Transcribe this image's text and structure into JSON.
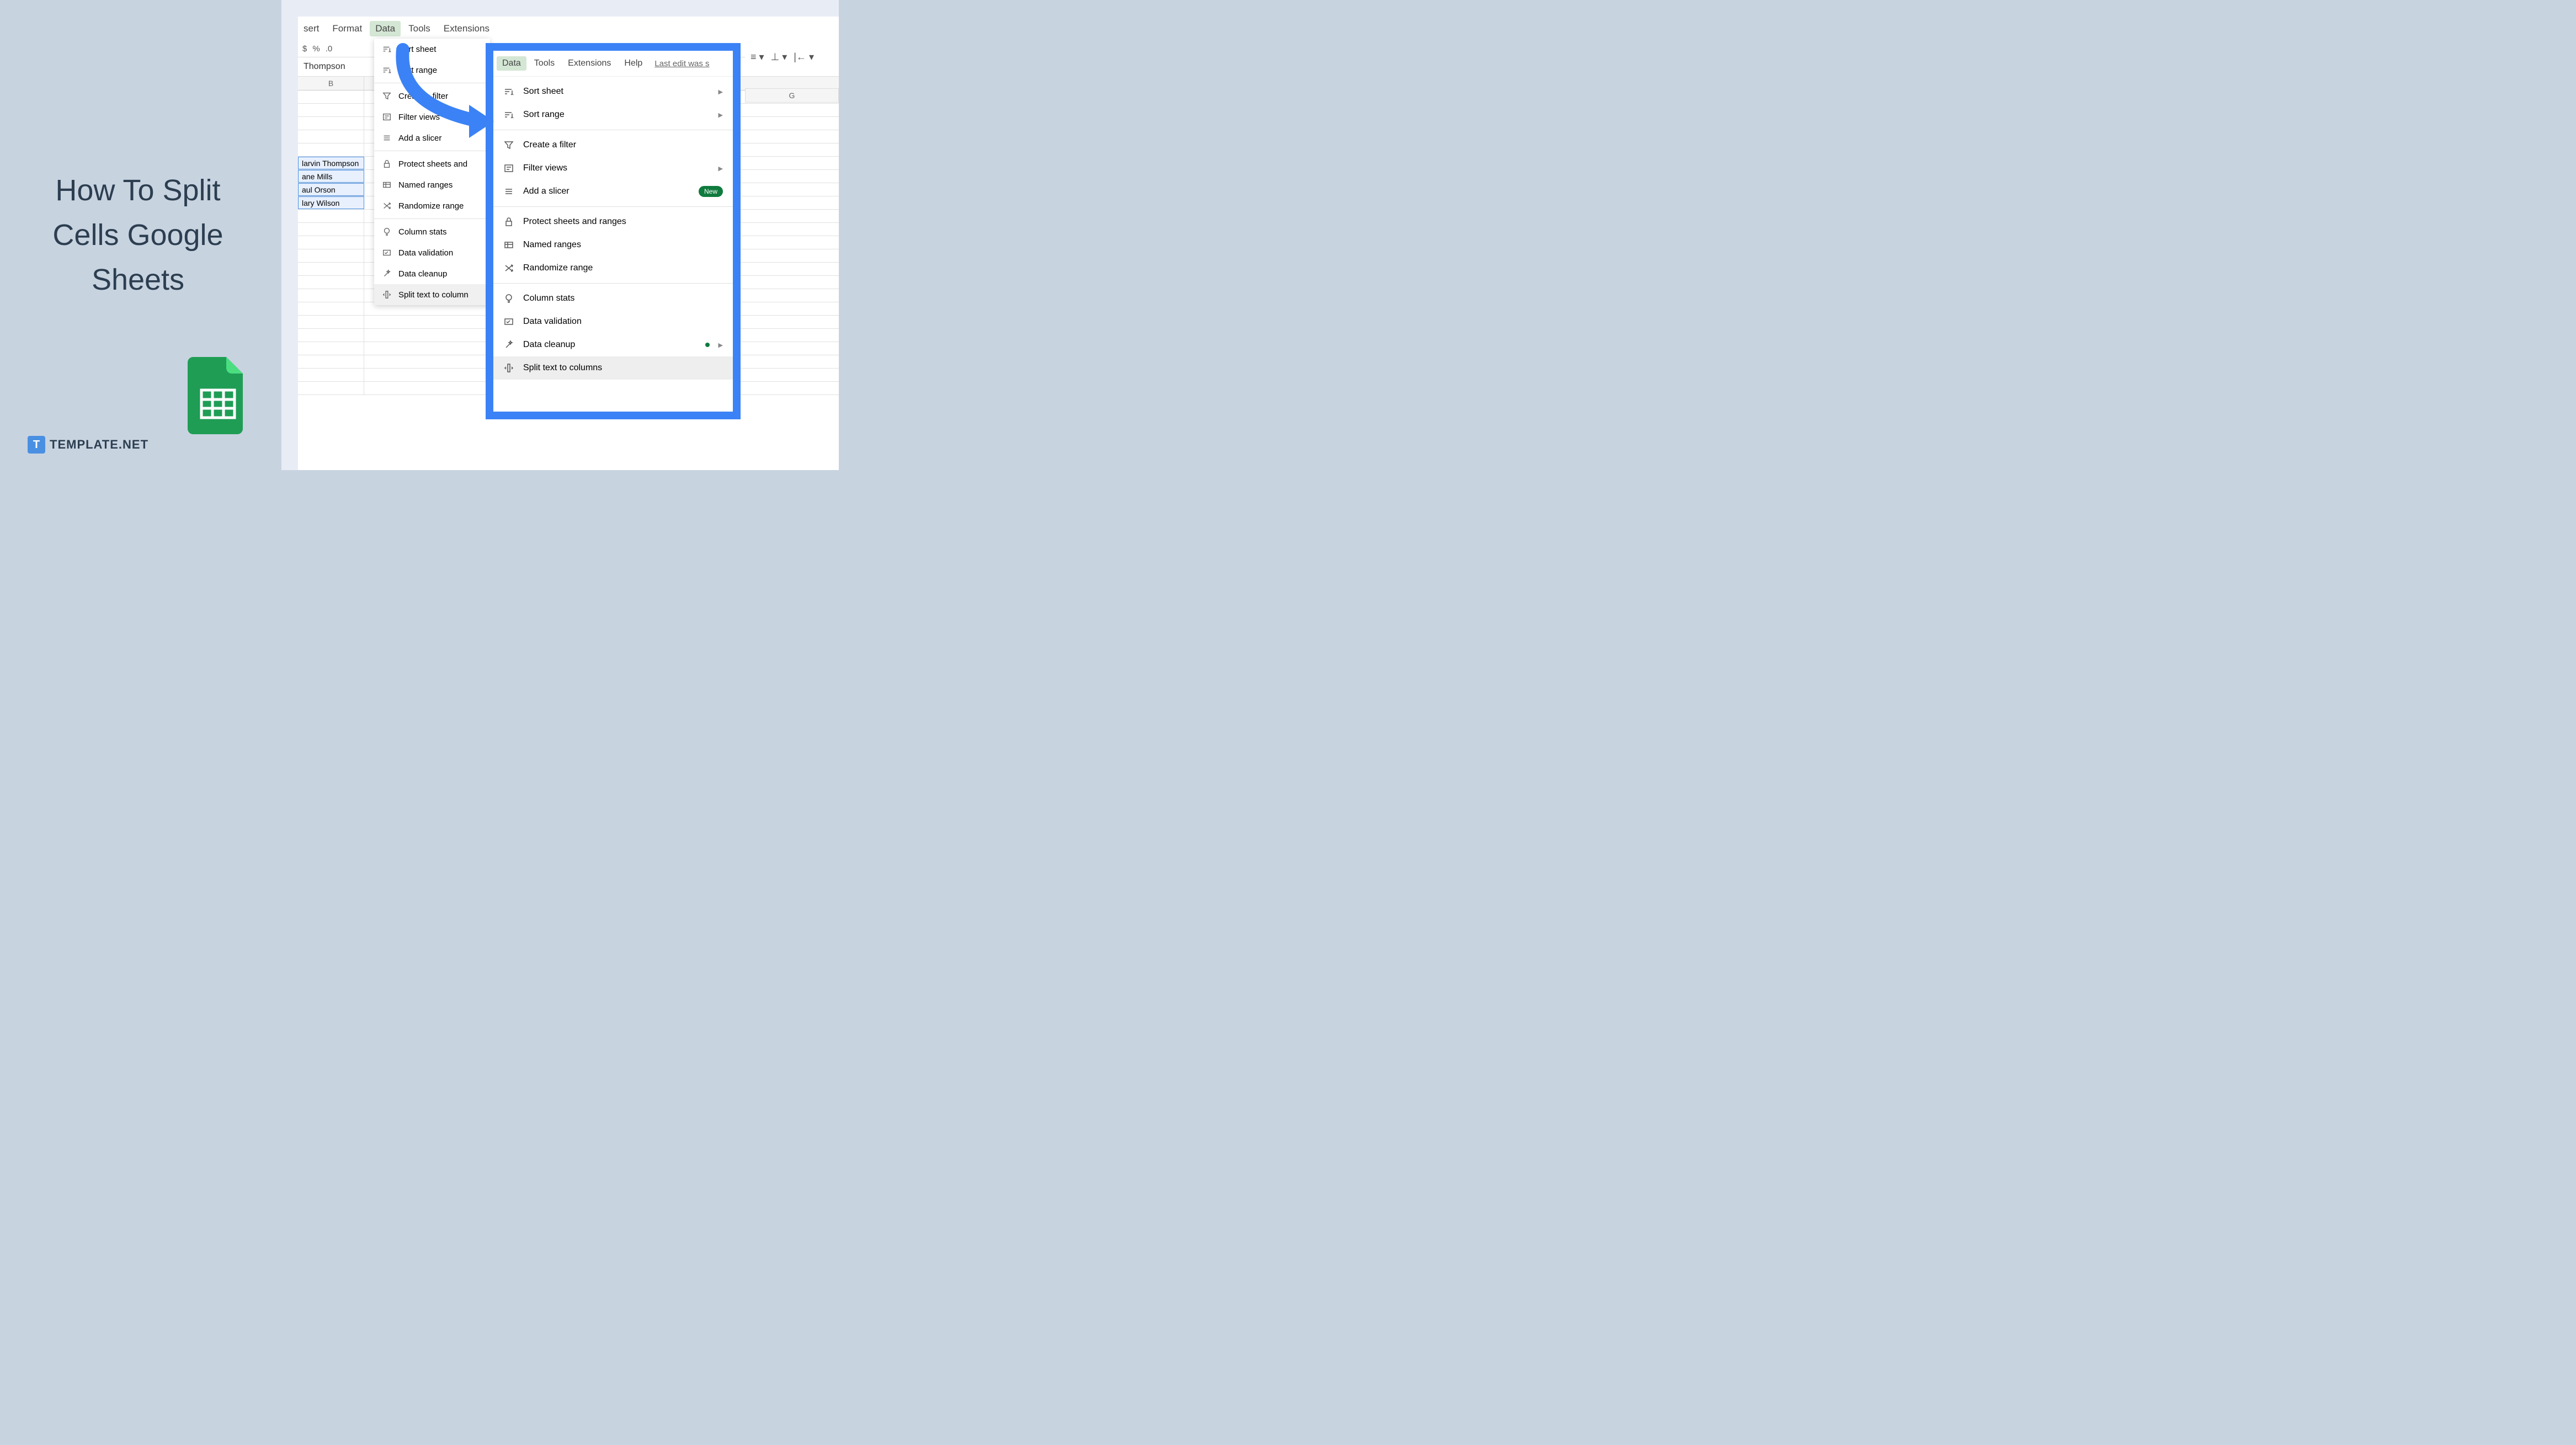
{
  "title": "How To Split Cells Google Sheets",
  "logo": {
    "icon": "T",
    "text": "TEMPLATE.NET"
  },
  "bg_menu": {
    "items": [
      "sert",
      "Format",
      "Data",
      "Tools",
      "Extensions"
    ],
    "active_index": 2
  },
  "bg_toolbar": [
    "$",
    "%",
    ".0"
  ],
  "bg_formula": "Thompson",
  "bg_col": "B",
  "bg_cells": [
    "larvin Thompson",
    "ane Mills",
    "aul Orson",
    "lary Wilson"
  ],
  "bg_dropdown": [
    {
      "label": "Sort sheet",
      "icon": "sort"
    },
    {
      "label": "Sort range",
      "icon": "sort"
    },
    {
      "sep": true
    },
    {
      "label": "Create a filter",
      "icon": "filter"
    },
    {
      "label": "Filter views",
      "icon": "filterview"
    },
    {
      "label": "Add a slicer",
      "icon": "slicer"
    },
    {
      "sep": true
    },
    {
      "label": "Protect sheets and",
      "icon": "lock"
    },
    {
      "label": "Named ranges",
      "icon": "named"
    },
    {
      "label": "Randomize range",
      "icon": "random"
    },
    {
      "sep": true
    },
    {
      "label": "Column stats",
      "icon": "bulb"
    },
    {
      "label": "Data validation",
      "icon": "check"
    },
    {
      "label": "Data cleanup",
      "icon": "wand"
    },
    {
      "label": "Split text to column",
      "icon": "split",
      "hover": true
    }
  ],
  "fg_menu": {
    "items": [
      "Data",
      "Tools",
      "Extensions",
      "Help"
    ],
    "active_index": 0,
    "edit": "Last edit was s"
  },
  "fg_dropdown": [
    {
      "label": "Sort sheet",
      "icon": "sort",
      "arrow": true
    },
    {
      "label": "Sort range",
      "icon": "sort",
      "arrow": true
    },
    {
      "sep": true
    },
    {
      "label": "Create a filter",
      "icon": "filter"
    },
    {
      "label": "Filter views",
      "icon": "filterview",
      "arrow": true
    },
    {
      "label": "Add a slicer",
      "icon": "slicer",
      "badge": "New"
    },
    {
      "sep": true
    },
    {
      "label": "Protect sheets and ranges",
      "icon": "lock"
    },
    {
      "label": "Named ranges",
      "icon": "named"
    },
    {
      "label": "Randomize range",
      "icon": "random"
    },
    {
      "sep": true
    },
    {
      "label": "Column stats",
      "icon": "bulb"
    },
    {
      "label": "Data validation",
      "icon": "check"
    },
    {
      "label": "Data cleanup",
      "icon": "wand",
      "dot": true,
      "arrow": true
    },
    {
      "label": "Split text to columns",
      "icon": "split",
      "hover": true
    }
  ],
  "right_col": "G",
  "right_toolbar_icons": [
    "align",
    "underline",
    "border"
  ]
}
